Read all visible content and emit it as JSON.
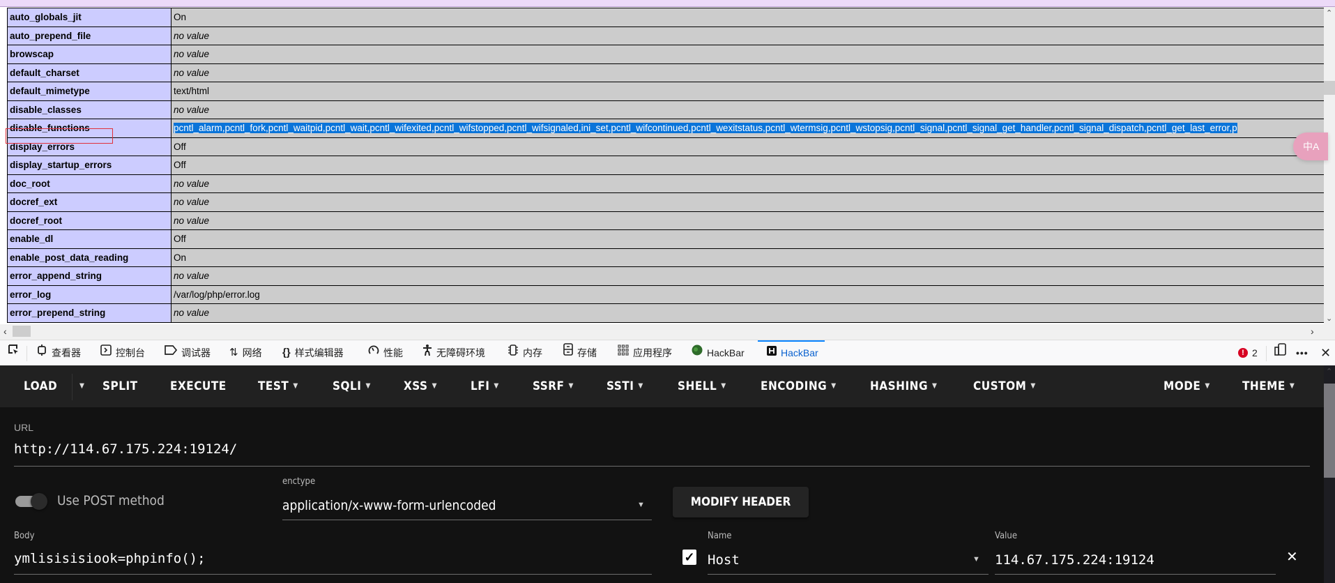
{
  "phpinfo": {
    "rows": [
      {
        "key": "auto_globals_jit",
        "value": "On",
        "italic": false
      },
      {
        "key": "auto_prepend_file",
        "value": "no value",
        "italic": true
      },
      {
        "key": "browscap",
        "value": "no value",
        "italic": true
      },
      {
        "key": "default_charset",
        "value": "no value",
        "italic": true
      },
      {
        "key": "default_mimetype",
        "value": "text/html",
        "italic": false
      },
      {
        "key": "disable_classes",
        "value": "no value",
        "italic": true
      },
      {
        "key": "disable_functions",
        "value": "pcntl_alarm,pcntl_fork,pcntl_waitpid,pcntl_wait,pcntl_wifexited,pcntl_wifstopped,pcntl_wifsignaled,ini_set,pcntl_wifcontinued,pcntl_wexitstatus,pcntl_wtermsig,pcntl_wstopsig,pcntl_signal,pcntl_signal_get_handler,pcntl_signal_dispatch,pcntl_get_last_error,p",
        "italic": false,
        "selected": true
      },
      {
        "key": "display_errors",
        "value": "Off",
        "italic": false
      },
      {
        "key": "display_startup_errors",
        "value": "Off",
        "italic": false
      },
      {
        "key": "doc_root",
        "value": "no value",
        "italic": true
      },
      {
        "key": "docref_ext",
        "value": "no value",
        "italic": true
      },
      {
        "key": "docref_root",
        "value": "no value",
        "italic": true
      },
      {
        "key": "enable_dl",
        "value": "Off",
        "italic": false
      },
      {
        "key": "enable_post_data_reading",
        "value": "On",
        "italic": false
      },
      {
        "key": "error_append_string",
        "value": "no value",
        "italic": true
      },
      {
        "key": "error_log",
        "value": "/var/log/php/error.log",
        "italic": false
      },
      {
        "key": "error_prepend_string",
        "value": "no value",
        "italic": true
      }
    ]
  },
  "translate_button": {
    "label": "中A"
  },
  "devtools": {
    "tabs": [
      {
        "id": "picker",
        "label": "",
        "icon": "element-picker-icon"
      },
      {
        "id": "inspector",
        "label": "查看器",
        "icon": "inspector-icon"
      },
      {
        "id": "console",
        "label": "控制台",
        "icon": "console-icon"
      },
      {
        "id": "debugger",
        "label": "调试器",
        "icon": "debugger-icon"
      },
      {
        "id": "network",
        "label": "网络",
        "icon": "network-icon"
      },
      {
        "id": "style-editor",
        "label": "样式编辑器",
        "icon": "braces-icon"
      },
      {
        "id": "performance",
        "label": "性能",
        "icon": "gauge-icon"
      },
      {
        "id": "accessibility",
        "label": "无障碍环境",
        "icon": "accessibility-icon"
      },
      {
        "id": "memory",
        "label": "内存",
        "icon": "memory-chip-icon"
      },
      {
        "id": "storage",
        "label": "存储",
        "icon": "storage-icon"
      },
      {
        "id": "application",
        "label": "应用程序",
        "icon": "grid-icon"
      },
      {
        "id": "hackbar-1",
        "label": "HackBar",
        "icon": "hackbar-green-icon"
      },
      {
        "id": "hackbar-2",
        "label": "HackBar",
        "icon": "hackbar-h-icon",
        "active": true
      }
    ],
    "error_count": "2",
    "accent": "#0a84ff"
  },
  "hackbar": {
    "menu": {
      "load": "LOAD",
      "split": "SPLIT",
      "execute": "EXECUTE",
      "test": "TEST",
      "sqli": "SQLI",
      "xss": "XSS",
      "lfi": "LFI",
      "ssrf": "SSRF",
      "ssti": "SSTI",
      "shell": "SHELL",
      "encoding": "ENCODING",
      "hashing": "HASHING",
      "custom": "CUSTOM",
      "mode": "MODE",
      "theme": "THEME"
    },
    "url_label": "URL",
    "url_value": "http://114.67.175.224:19124/",
    "post_toggle_label": "Use POST method",
    "post_enabled": true,
    "enctype_label": "enctype",
    "enctype_value": "application/x-www-form-urlencoded",
    "modify_header_label": "MODIFY HEADER",
    "body_label": "Body",
    "body_value": "ymlisisisiook=phpinfo();",
    "header": {
      "name_label": "Name",
      "name_value": "Host",
      "value_label": "Value",
      "value_value": "114.67.175.224:19124",
      "enabled": true
    }
  }
}
